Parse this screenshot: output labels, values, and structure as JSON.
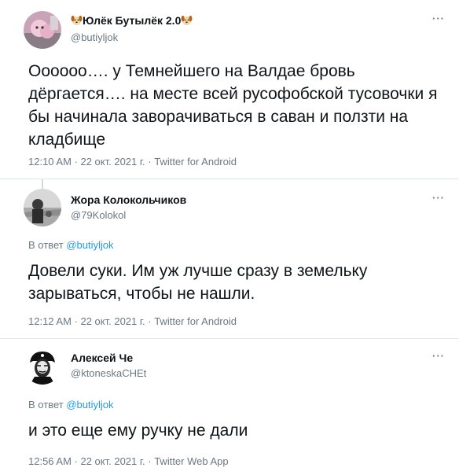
{
  "tweets": [
    {
      "name": "Юлёк Бутылёк 2.0",
      "handle": "@butiyljok",
      "text_lines": [
        "Оооооо…. у Темнейшего на Валдае бровь",
        "дёргается…. на месте всей русофобской тусовочки я",
        "бы начинала заворачиваться в саван и ползти на",
        "кладбище"
      ],
      "meta": "12:10 AM · 22 окт. 2021 г. · Twitter for Android",
      "more": "···"
    },
    {
      "name": "Жора Колокольчиков",
      "handle": "@79Kolokol",
      "reply_prefix": "В ответ",
      "reply_mention": "@butiyljok",
      "text_lines": [
        "Довели суки. Им уж лучше сразу в земельку",
        "зарываться, чтобы не нашли."
      ],
      "meta": "12:12 AM · 22 окт. 2021 г. · Twitter for Android",
      "more": "···"
    },
    {
      "name": "Алексей Че",
      "handle": "@ktoneskaCHEt",
      "reply_prefix": "В ответ",
      "reply_mention": "@butiyljok",
      "text_lines": [
        "и это еще ему ручку не дали"
      ],
      "meta": "12:56 AM · 22 окт. 2021 г. · Twitter Web App",
      "more": "···"
    }
  ],
  "icons": {
    "name_emoji": "dog-face-icon"
  },
  "colors": {
    "text": "#0f1419",
    "secondary": "#6b7882",
    "link": "#1d9bf0",
    "separator": "#e3e8ec"
  }
}
